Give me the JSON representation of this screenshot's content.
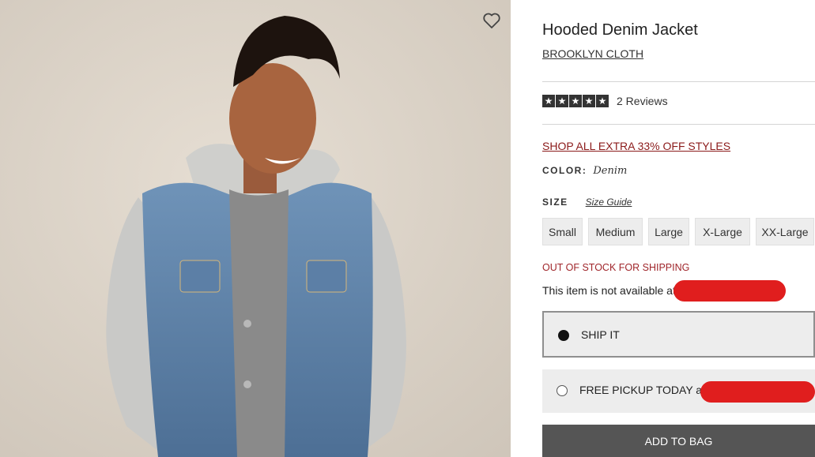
{
  "product": {
    "title": "Hooded Denim Jacket",
    "brand": "BROOKLYN CLOTH",
    "rating": {
      "stars": 5,
      "reviews_label": "2 Reviews"
    },
    "promo_link": "SHOP ALL EXTRA 33% OFF STYLES",
    "color": {
      "label": "COLOR:",
      "value": "Denim"
    },
    "size": {
      "label": "SIZE",
      "guide_label": "Size Guide",
      "options": [
        "Small",
        "Medium",
        "Large",
        "X-Large",
        "XX-Large"
      ]
    },
    "stock_status": "OUT OF STOCK FOR SHIPPING",
    "availability_text": "This item is not available at",
    "fulfillment": {
      "ship_label": "SHIP IT",
      "pickup_label": "FREE PICKUP TODAY at"
    },
    "add_to_bag_label": "ADD TO BAG"
  },
  "icons": {
    "favorite": "heart-outline-icon",
    "star": "star-icon"
  },
  "colors": {
    "promo": "#8b1a1a",
    "stock_status": "#a0262b",
    "add_button": "#555555",
    "redaction": "#e01e1e"
  }
}
